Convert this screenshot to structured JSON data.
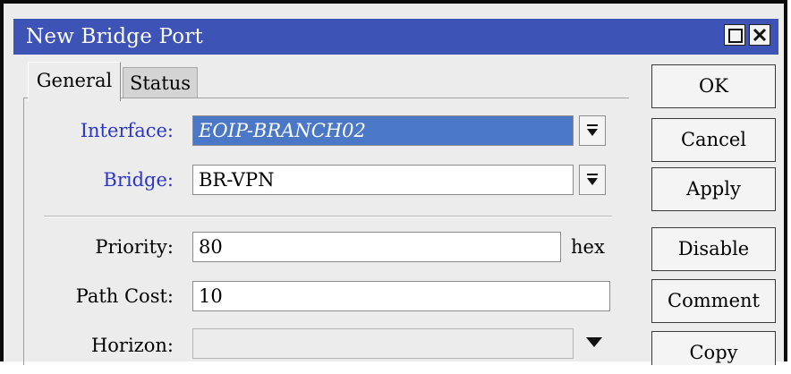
{
  "window": {
    "title": "New Bridge Port",
    "maximize_icon": "maximize-icon",
    "close_icon": "close-icon"
  },
  "tabs": [
    {
      "label": "General",
      "active": true
    },
    {
      "label": "Status",
      "active": false
    }
  ],
  "form": {
    "interface": {
      "label": "Interface:",
      "value": "EOIP-BRANCH02"
    },
    "bridge": {
      "label": "Bridge:",
      "value": "BR-VPN"
    },
    "priority": {
      "label": "Priority:",
      "value": "80",
      "unit": "hex"
    },
    "path_cost": {
      "label": "Path Cost:",
      "value": "10"
    },
    "horizon": {
      "label": "Horizon:",
      "value": ""
    }
  },
  "buttons": {
    "ok": "OK",
    "cancel": "Cancel",
    "apply": "Apply",
    "disable": "Disable",
    "comment": "Comment",
    "copy": "Copy"
  },
  "colors": {
    "titlebar": "#3d53b5",
    "label_accent": "#2b36c8",
    "selection": "#4a78c7"
  }
}
